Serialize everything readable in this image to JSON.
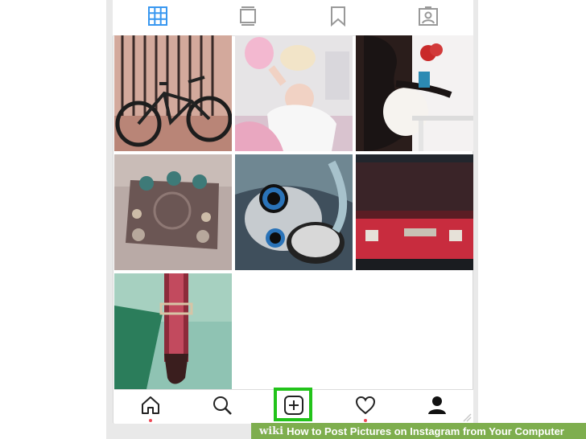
{
  "profile_tabs": [
    {
      "name": "grid-icon",
      "color": "#3897f0"
    },
    {
      "name": "feed-icon",
      "color": "#999999"
    },
    {
      "name": "bookmark-icon",
      "color": "#999999"
    },
    {
      "name": "tagged-icon",
      "color": "#999999"
    }
  ],
  "posts": [
    {
      "subject": "bicycle"
    },
    {
      "subject": "baby-in-crib"
    },
    {
      "subject": "pregnant-woman"
    },
    {
      "subject": "guitar-pedal"
    },
    {
      "subject": "plush-toy"
    },
    {
      "subject": "red-case"
    },
    {
      "subject": "guitar-strap"
    }
  ],
  "bottom_nav": [
    {
      "name": "home-icon",
      "notification_dot": true
    },
    {
      "name": "search-icon",
      "notification_dot": false
    },
    {
      "name": "new-post-icon",
      "notification_dot": false
    },
    {
      "name": "activity-heart-icon",
      "notification_dot": true
    },
    {
      "name": "profile-icon",
      "notification_dot": false
    }
  ],
  "colors": {
    "accent": "#3897f0",
    "highlight": "#22c31a",
    "notification": "#ed4956",
    "banner": "#7eae4e"
  },
  "banner": {
    "brand": "wiki",
    "title": "How to Post Pictures on Instagram from Your Computer"
  }
}
